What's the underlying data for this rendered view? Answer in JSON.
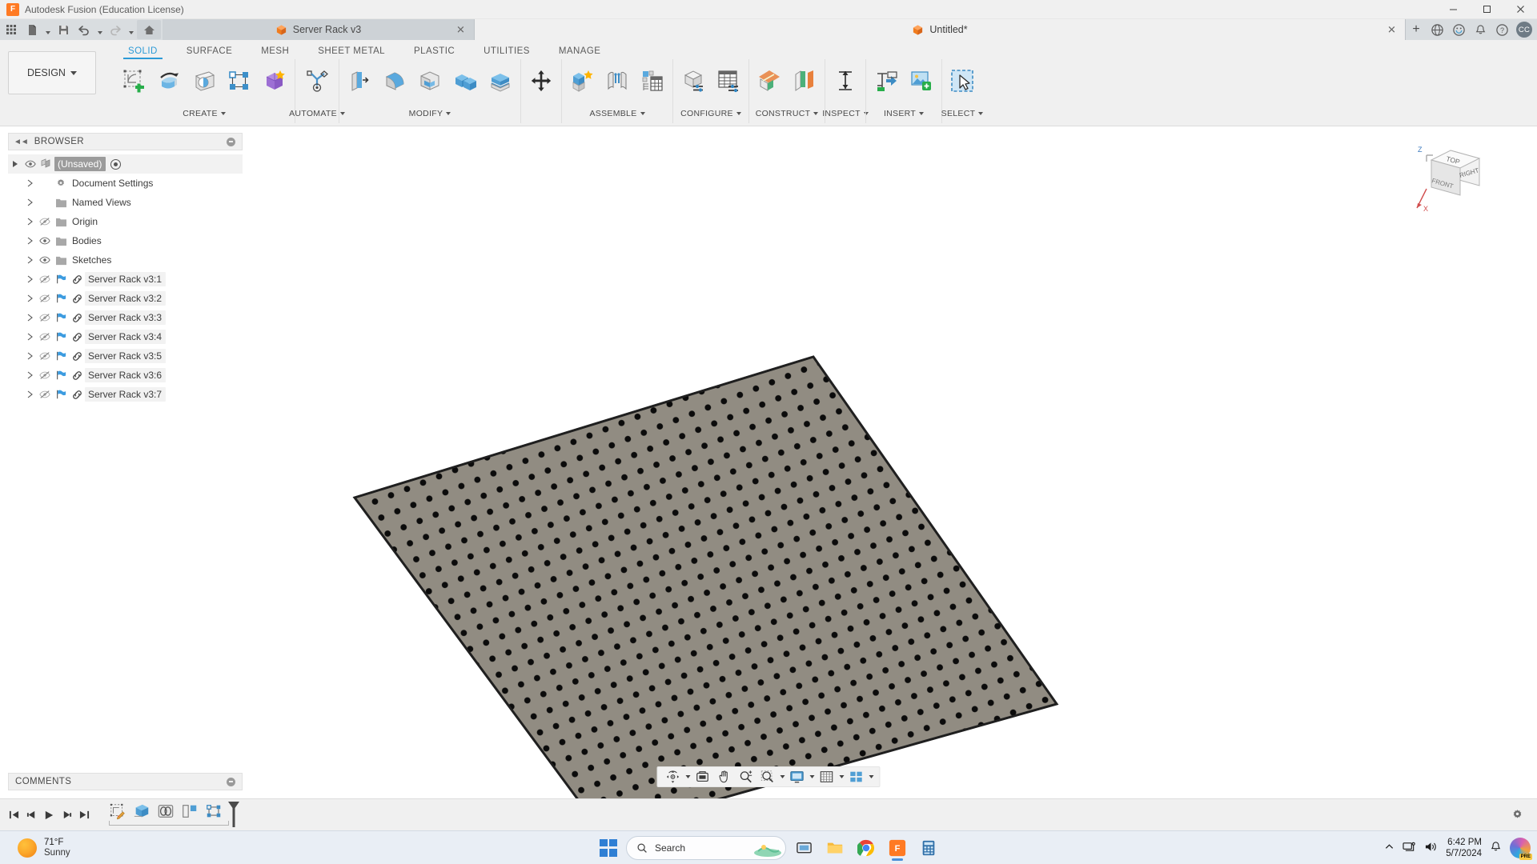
{
  "window": {
    "app_title": "Autodesk Fusion (Education License)",
    "app_icon": "fusion-logo-icon",
    "minimize": "–",
    "maximize": "☐",
    "close": "✕"
  },
  "quick_access": {
    "grid_label": "apps-grid-icon",
    "new_label": "new-document-icon",
    "save_label": "save-icon",
    "undo_label": "undo-icon",
    "redo_label": "redo-icon",
    "home_label": "home-icon"
  },
  "doc_tabs": [
    {
      "title": "Server Rack v3",
      "active": false,
      "close": "✕"
    },
    {
      "title": "Untitled*",
      "active": true,
      "close": "✕"
    }
  ],
  "tab_actions": {
    "new_tab": "+",
    "help_community": "community-icon",
    "notification_center": "notifications-icon",
    "alerts": "bell-icon",
    "help": "?",
    "account_initials": "CC"
  },
  "ribbon": {
    "workspace_label": "DESIGN",
    "tabs": [
      {
        "label": "SOLID",
        "active": true
      },
      {
        "label": "SURFACE",
        "active": false
      },
      {
        "label": "MESH",
        "active": false
      },
      {
        "label": "SHEET METAL",
        "active": false
      },
      {
        "label": "PLASTIC",
        "active": false
      },
      {
        "label": "UTILITIES",
        "active": false
      },
      {
        "label": "MANAGE",
        "active": false
      }
    ],
    "panels": [
      {
        "label": "CREATE",
        "has_caret": true,
        "tools": [
          "create-sketch-icon",
          "revolve-icon",
          "cylinder-icon",
          "pattern-icon",
          "new-component-icon"
        ]
      },
      {
        "label": "AUTOMATE",
        "has_caret": true,
        "tools": [
          "automate-icon"
        ]
      },
      {
        "label": "MODIFY",
        "has_caret": true,
        "tools": [
          "press-pull-icon",
          "fillet-icon",
          "shell-icon",
          "combine-icon",
          "offset-face-icon"
        ]
      },
      {
        "label": "",
        "has_caret": false,
        "tools": [
          "move-copy-icon"
        ]
      },
      {
        "label": "ASSEMBLE",
        "has_caret": true,
        "tools": [
          "new-component-assemble-icon",
          "joint-icon",
          "joint-origin-icon"
        ]
      },
      {
        "label": "CONFIGURE",
        "has_caret": true,
        "tools": [
          "configure-icon",
          "configuration-table-icon"
        ]
      },
      {
        "label": "CONSTRUCT",
        "has_caret": true,
        "tools": [
          "offset-plane-icon",
          "plane-through-icon"
        ]
      },
      {
        "label": "INSPECT",
        "has_caret": true,
        "tools": [
          "measure-icon"
        ]
      },
      {
        "label": "INSERT",
        "has_caret": true,
        "tools": [
          "insert-derive-icon",
          "insert-mcmaster-icon"
        ]
      },
      {
        "label": "SELECT",
        "has_caret": true,
        "tools": [
          "select-icon"
        ]
      }
    ]
  },
  "browser": {
    "title": "BROWSER",
    "collapse_icon": "collapse-left-icon",
    "options_icon": "panel-options-icon",
    "nodes": [
      {
        "label": "(Unsaved)",
        "level": 0,
        "icon": "component-icon",
        "eye": "visible",
        "root": true,
        "has_radio": true
      },
      {
        "label": "Document Settings",
        "level": 1,
        "icon": "gear-icon",
        "eye": "none"
      },
      {
        "label": "Named Views",
        "level": 1,
        "icon": "folder-icon",
        "eye": "none"
      },
      {
        "label": "Origin",
        "level": 1,
        "icon": "folder-icon",
        "eye": "hidden"
      },
      {
        "label": "Bodies",
        "level": 1,
        "icon": "folder-icon",
        "eye": "visible"
      },
      {
        "label": "Sketches",
        "level": 1,
        "icon": "folder-icon",
        "eye": "visible"
      },
      {
        "label": "Server Rack v3:1",
        "level": 1,
        "icon": "linked-component-icon",
        "eye": "hidden",
        "flag": true
      },
      {
        "label": "Server Rack v3:2",
        "level": 1,
        "icon": "linked-component-icon",
        "eye": "hidden",
        "flag": true
      },
      {
        "label": "Server Rack v3:3",
        "level": 1,
        "icon": "linked-component-icon",
        "eye": "hidden",
        "flag": true
      },
      {
        "label": "Server Rack v3:4",
        "level": 1,
        "icon": "linked-component-icon",
        "eye": "hidden",
        "flag": true
      },
      {
        "label": "Server Rack v3:5",
        "level": 1,
        "icon": "linked-component-icon",
        "eye": "hidden",
        "flag": true
      },
      {
        "label": "Server Rack v3:6",
        "level": 1,
        "icon": "linked-component-icon",
        "eye": "hidden",
        "flag": true
      },
      {
        "label": "Server Rack v3:7",
        "level": 1,
        "icon": "linked-component-icon",
        "eye": "hidden",
        "flag": true
      }
    ]
  },
  "canvas": {
    "model_description": "perforated-panel-body",
    "body_fill": "#928d83",
    "body_edge": "#2d2d2d",
    "hole_color": "#000000",
    "viewcube": {
      "top_label": "TOP",
      "front_label": "FRONT",
      "right_label": "RIGHT",
      "axis_z": "Z",
      "axis_x": "X"
    }
  },
  "view_navbar": {
    "items": [
      {
        "name": "orbit-icon",
        "caret": true
      },
      {
        "name": "look-at-icon",
        "caret": false
      },
      {
        "name": "pan-icon",
        "caret": false
      },
      {
        "name": "zoom-icon",
        "caret": false
      },
      {
        "name": "zoom-window-icon",
        "caret": true
      },
      {
        "name": "display-settings-icon",
        "caret": true
      },
      {
        "name": "grid-snaps-icon",
        "caret": true
      },
      {
        "name": "viewports-icon",
        "caret": true
      }
    ]
  },
  "comments": {
    "title": "COMMENTS",
    "options_icon": "panel-options-icon"
  },
  "timeline": {
    "playback": [
      "go-to-beginning-icon",
      "step-back-icon",
      "play-icon",
      "step-forward-icon",
      "go-to-end-icon"
    ],
    "features": [
      "sketch-feature-icon",
      "extrude-feature-icon",
      "rectangular-pattern-feature-icon",
      "mirror-feature-icon",
      "component-feature-icon"
    ],
    "marker": "timeline-marker",
    "settings_icon": "timeline-settings-icon"
  },
  "taskbar": {
    "weather": {
      "temperature": "71°F",
      "condition": "Sunny",
      "icon": "sun-icon"
    },
    "start": "windows-start-icon",
    "search": {
      "placeholder": "Search",
      "icon": "search-icon"
    },
    "pinned": [
      {
        "name": "task-view-icon",
        "active": false
      },
      {
        "name": "file-explorer-icon",
        "active": false
      },
      {
        "name": "google-chrome-icon",
        "active": false
      },
      {
        "name": "autodesk-fusion-icon",
        "active": true
      },
      {
        "name": "calculator-icon",
        "active": false
      }
    ],
    "tray": {
      "chevron": "show-hidden-icons-icon",
      "network": "network-icon",
      "volume": "volume-icon",
      "time": "6:42 PM",
      "date": "5/7/2024",
      "notifications": "bell-icon",
      "copilot": "copilot-icon"
    }
  }
}
